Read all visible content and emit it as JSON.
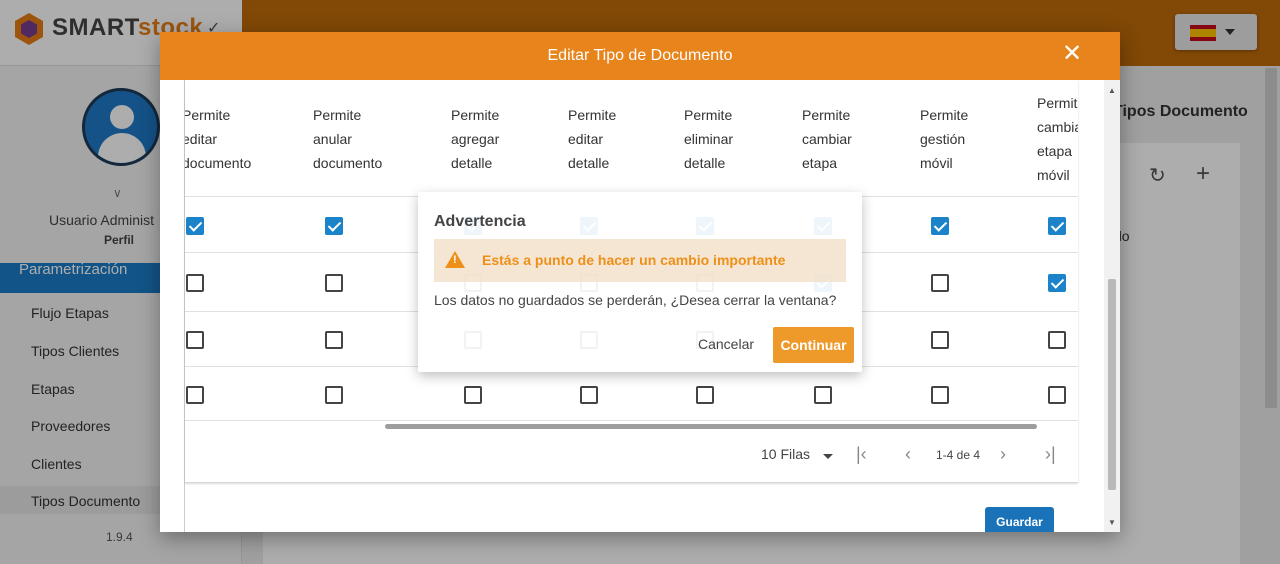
{
  "app": {
    "logo_text_a": "SMART",
    "logo_text_b": "stock",
    "version": "1.9.4"
  },
  "sidebar": {
    "user_name": "Usuario Administ",
    "profile_label": "Perfil",
    "section_header": "Parametrización",
    "items": [
      {
        "label": "Flujo Etapas"
      },
      {
        "label": "Tipos Clientes"
      },
      {
        "label": "Etapas"
      },
      {
        "label": "Proveedores"
      },
      {
        "label": "Clientes"
      },
      {
        "label": "Tipos Documento"
      }
    ]
  },
  "background": {
    "page_title": "Tipos Documento",
    "row_text": "do"
  },
  "modal": {
    "title": "Editar Tipo de Documento",
    "columns": [
      {
        "lines": [
          "Permite",
          "editar",
          "documento"
        ]
      },
      {
        "lines": [
          "Permite",
          "anular",
          "documento"
        ]
      },
      {
        "lines": [
          "Permite",
          "agregar",
          "detalle"
        ]
      },
      {
        "lines": [
          "Permite",
          "editar",
          "detalle"
        ]
      },
      {
        "lines": [
          "Permite",
          "eliminar",
          "detalle"
        ]
      },
      {
        "lines": [
          "Permite",
          "cambiar",
          "etapa"
        ]
      },
      {
        "lines": [
          "Permite",
          "gestión",
          "móvil"
        ]
      },
      {
        "lines": [
          "Permite",
          "cambiar",
          "etapa",
          "móvil"
        ]
      }
    ],
    "rows": [
      [
        true,
        true,
        true,
        true,
        true,
        true,
        true,
        true
      ],
      [
        false,
        false,
        false,
        false,
        false,
        true,
        false,
        true
      ],
      [
        false,
        false,
        false,
        false,
        false,
        false,
        false,
        false
      ],
      [
        false,
        false,
        false,
        false,
        false,
        false,
        false,
        false
      ]
    ],
    "pagination": {
      "rows_per_page": "10 Filas",
      "range": "1-4 de 4"
    },
    "save_label": "Guardar"
  },
  "dialog": {
    "title": "Advertencia",
    "banner": "Estás a punto de hacer un cambio importante",
    "message": "Los datos no guardados se perderán, ¿Desea cerrar la ventana?",
    "cancel_label": "Cancelar",
    "continue_label": "Continuar"
  },
  "colors": {
    "header_orange": "#e8841c",
    "checkbox_blue": "#1a83c9",
    "warning_orange": "#ee8f17"
  },
  "icons": [
    "close-icon",
    "refresh-icon",
    "plus-icon",
    "warning-icon",
    "chevron-down-icon",
    "first-page-icon",
    "prev-page-icon",
    "next-page-icon",
    "last-page-icon"
  ]
}
